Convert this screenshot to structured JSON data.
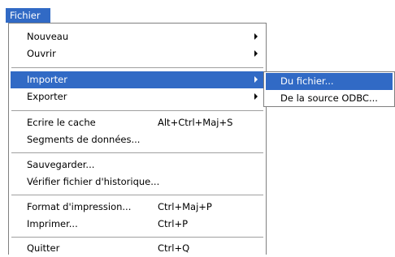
{
  "menubar": {
    "title": "Fichier"
  },
  "menu": {
    "items": [
      {
        "label": "Nouveau"
      },
      {
        "label": "Ouvrir"
      },
      {
        "label": "Importer"
      },
      {
        "label": "Exporter"
      },
      {
        "label": "Ecrire le cache",
        "shortcut": "Alt+Ctrl+Maj+S"
      },
      {
        "label": "Segments de données..."
      },
      {
        "label": "Sauvegarder..."
      },
      {
        "label": "Vérifier fichier d'historique..."
      },
      {
        "label": "Format d'impression...",
        "shortcut": "Ctrl+Maj+P"
      },
      {
        "label": "Imprimer...",
        "shortcut": "Ctrl+P"
      },
      {
        "label": "Quitter",
        "shortcut": "Ctrl+Q"
      }
    ]
  },
  "submenu": {
    "items": [
      {
        "label": "Du fichier..."
      },
      {
        "label": "De la source ODBC..."
      }
    ]
  }
}
